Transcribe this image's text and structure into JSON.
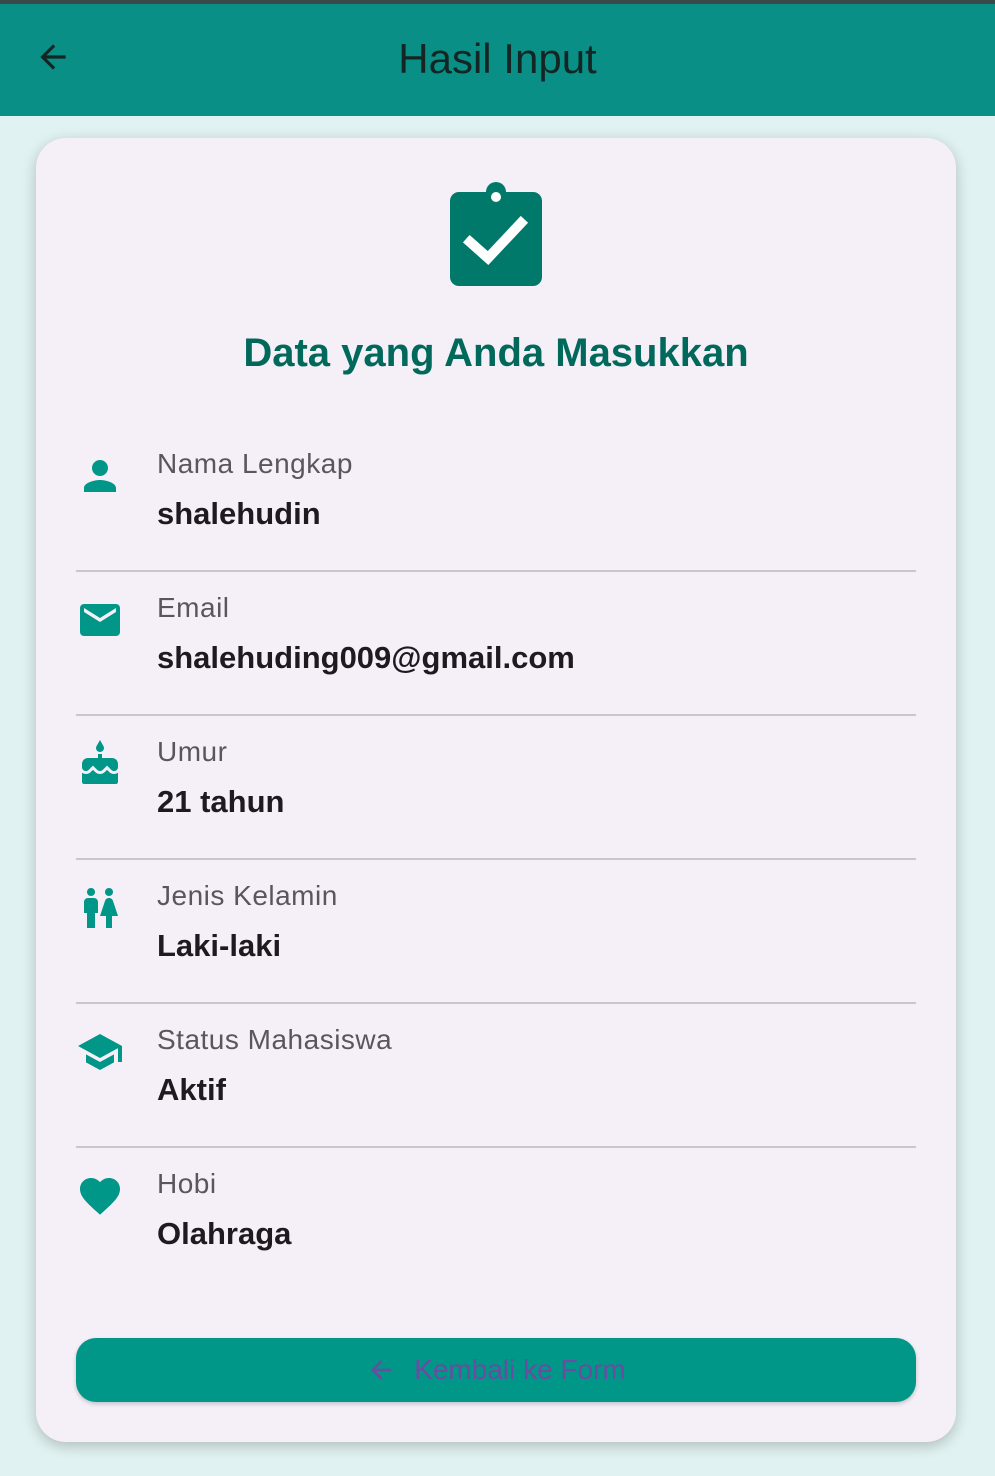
{
  "appbar": {
    "title": "Hasil Input",
    "back_icon": "arrow-back-icon"
  },
  "card": {
    "icon": "clipboard-check-icon",
    "heading": "Data yang Anda Masukkan",
    "rows": [
      {
        "icon": "person-icon",
        "label": "Nama Lengkap",
        "value": "shalehudin"
      },
      {
        "icon": "email-icon",
        "label": "Email",
        "value": "shalehuding009@gmail.com"
      },
      {
        "icon": "cake-icon",
        "label": "Umur",
        "value": "21 tahun"
      },
      {
        "icon": "wc-icon",
        "label": "Jenis Kelamin",
        "value": "Laki-laki"
      },
      {
        "icon": "school-icon",
        "label": "Status Mahasiswa",
        "value": "Aktif"
      },
      {
        "icon": "heart-icon",
        "label": "Hobi",
        "value": "Olahraga"
      }
    ]
  },
  "button": {
    "label": "Kembali ke Form",
    "icon": "arrow-back-icon"
  },
  "colors": {
    "appbar": "#0a8f87",
    "accent": "#009688",
    "heading": "#00695c",
    "background": "#e0f2f1",
    "card": "#f5f0f8",
    "button_text": "#6a4ca0"
  }
}
